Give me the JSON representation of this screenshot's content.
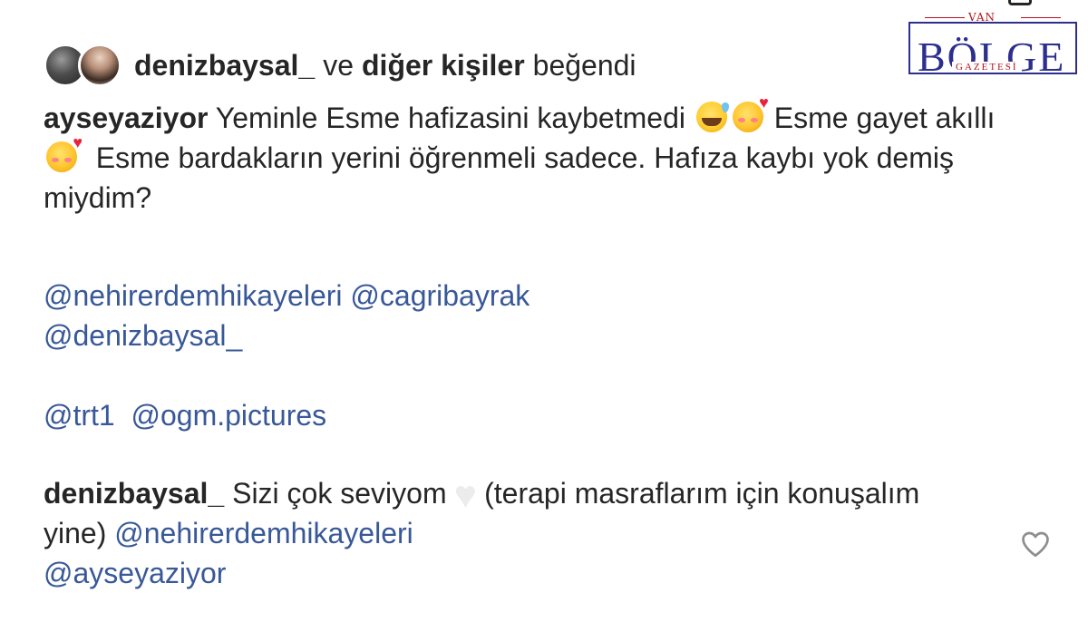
{
  "likes": {
    "first_user": "denizbaysal_",
    "connector": "ve",
    "others": "diğer kişiler",
    "suffix": "beğendi"
  },
  "comments": [
    {
      "username": "ayseyaziyor",
      "text_1": "Yeminle Esme hafizasini kaybetmedi",
      "text_2": "Esme gayet akıllı",
      "text_3": "Esme bardakların yerini öğrenmeli sadece. Hafıza kaybı yok demiş miydim?"
    },
    {
      "mention_1": "@nehirerdemhikayeleri",
      "mention_2": "@cagribayrak",
      "mention_3": "@denizbaysal_",
      "mention_4": "@trt1",
      "mention_5": "@ogm.pictures"
    },
    {
      "username": "denizbaysal_",
      "text_1": "Sizi çok seviyom",
      "text_2": "(terapi masraflarım için konuşalım yine)",
      "mention_1": "@nehirerdemhikayeleri",
      "mention_2": "@ayseyaziyor"
    }
  ],
  "icons": {
    "emoji_1": "grinning-sweat-emoji-icon",
    "emoji_2": "smiling-hearts-emoji-icon",
    "emoji_3": "white-heart-emoji-icon",
    "like": "heart-outline-icon"
  },
  "watermark": {
    "top": "VAN",
    "main": "BÖLGE",
    "sub": "GAZETESİ"
  },
  "colors": {
    "text": "#262626",
    "mention": "#385898",
    "logo_blue": "#2d2f8e",
    "logo_red": "#b5121b"
  }
}
